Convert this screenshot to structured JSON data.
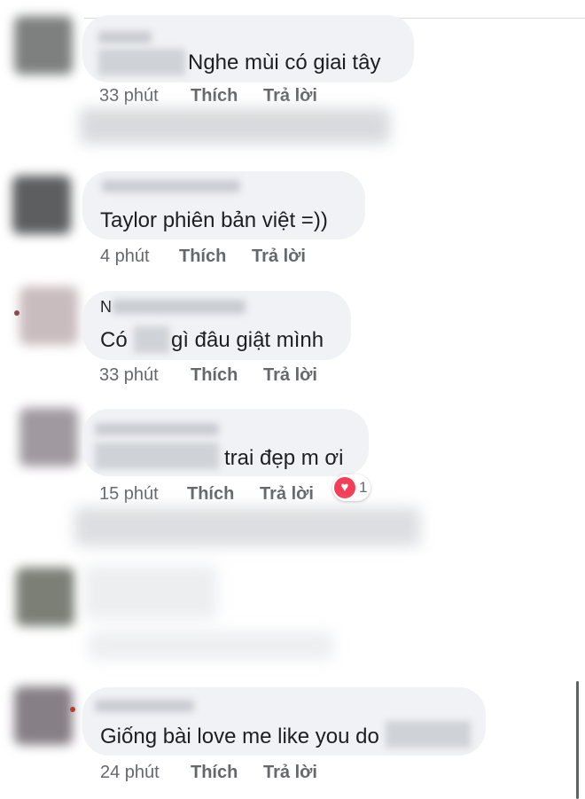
{
  "comments": [
    {
      "text": "Nghe mùi có giai tây",
      "time": "33 phút",
      "like": "Thích",
      "reply": "Trả lời"
    },
    {
      "text": "Taylor phiên bản việt =))",
      "time": "4 phút",
      "like": "Thích",
      "reply": "Trả lời"
    },
    {
      "name_prefix": "N",
      "text_a": "Có",
      "text_b": "gì đâu giật mình",
      "time": "33 phút",
      "like": "Thích",
      "reply": "Trả lời"
    },
    {
      "text": "trai đẹp m ơi",
      "time": "15 phút",
      "like": "Thích",
      "reply": "Trả lời",
      "reaction_count": "1",
      "reaction_icon": "heart-icon"
    },
    {
      "text": "Giống bài love me like you do",
      "time": "24 phút",
      "like": "Thích",
      "reply": "Trả lời"
    }
  ],
  "colors": {
    "bubble": "#f0f2f5",
    "meta": "#65676b",
    "heart": "#f33e58"
  }
}
